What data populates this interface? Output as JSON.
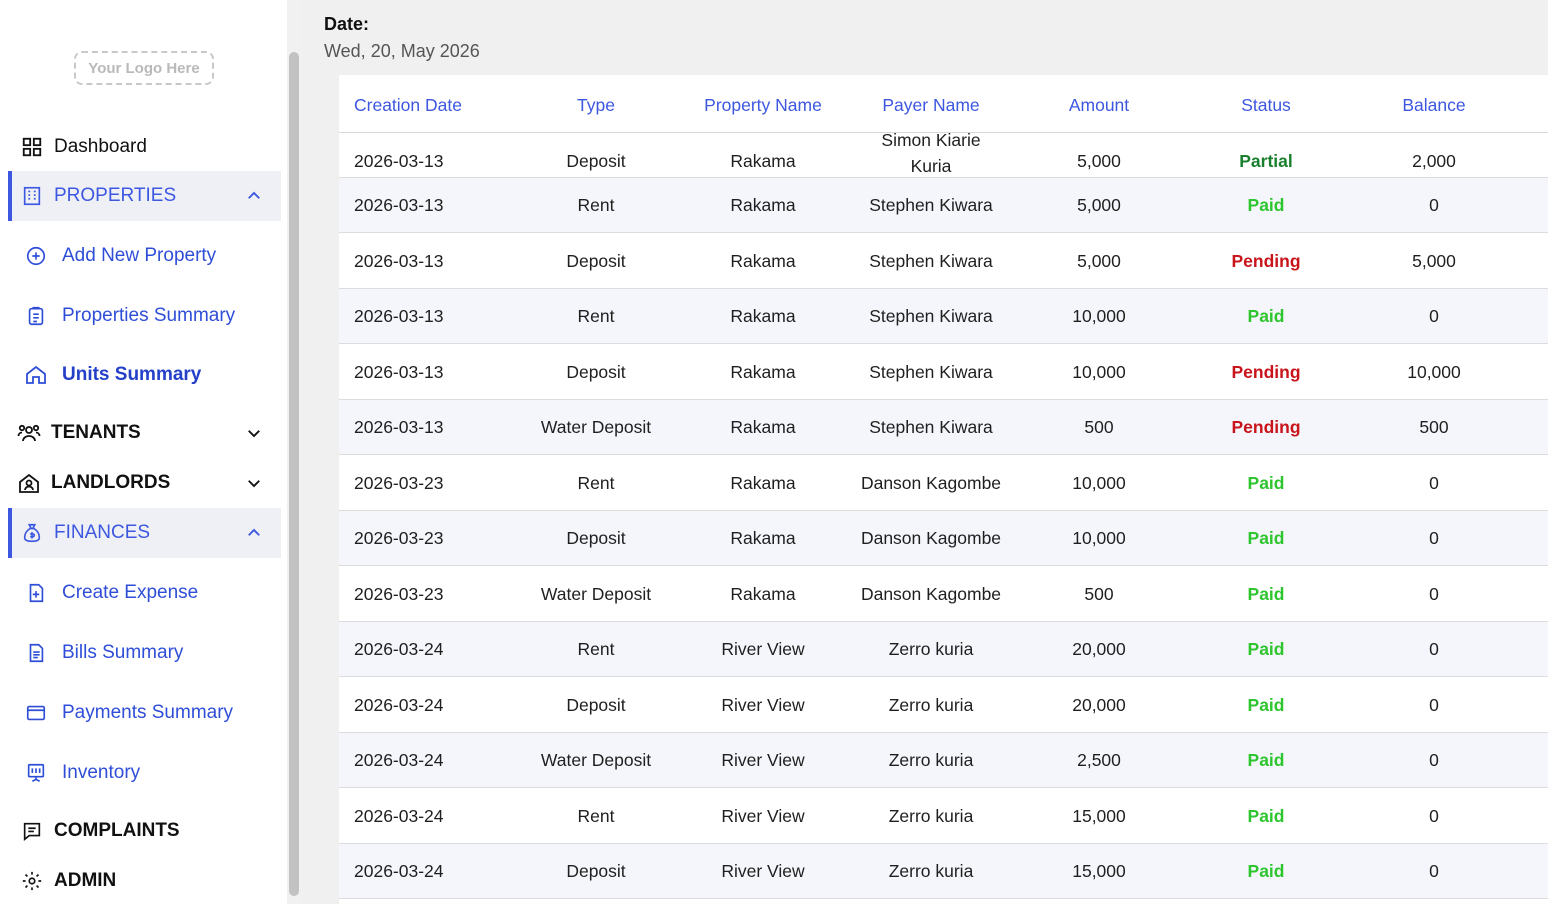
{
  "sidebar": {
    "logo_text": "Your Logo Here",
    "dashboard": "Dashboard",
    "properties": "PROPERTIES",
    "properties_sub": {
      "add_new_property": "Add New Property",
      "properties_summary": "Properties Summary",
      "units_summary": "Units Summary"
    },
    "tenants": "TENANTS",
    "landlords": "LANDLORDS",
    "finances": "FINANCES",
    "finances_sub": {
      "create_expense": "Create Expense",
      "bills_summary": "Bills Summary",
      "payments_summary": "Payments Summary",
      "inventory": "Inventory"
    },
    "complaints": "COMPLAINTS",
    "admin": "ADMIN"
  },
  "header": {
    "date_label": "Date:",
    "date_value": "Wed, 20, May 2026"
  },
  "table": {
    "columns": [
      "Creation Date",
      "Type",
      "Property Name",
      "Payer Name",
      "Amount",
      "Status",
      "Balance"
    ],
    "rows": [
      {
        "date": "2026-03-13",
        "type": "Deposit",
        "property": "Rakama",
        "payer": "Simon Kiarie Kuria",
        "amount": "5,000",
        "status": "Partial",
        "balance": "2,000"
      },
      {
        "date": "2026-03-13",
        "type": "Rent",
        "property": "Rakama",
        "payer": "Stephen Kiwara",
        "amount": "5,000",
        "status": "Paid",
        "balance": "0"
      },
      {
        "date": "2026-03-13",
        "type": "Deposit",
        "property": "Rakama",
        "payer": "Stephen Kiwara",
        "amount": "5,000",
        "status": "Pending",
        "balance": "5,000"
      },
      {
        "date": "2026-03-13",
        "type": "Rent",
        "property": "Rakama",
        "payer": "Stephen Kiwara",
        "amount": "10,000",
        "status": "Paid",
        "balance": "0"
      },
      {
        "date": "2026-03-13",
        "type": "Deposit",
        "property": "Rakama",
        "payer": "Stephen Kiwara",
        "amount": "10,000",
        "status": "Pending",
        "balance": "10,000"
      },
      {
        "date": "2026-03-13",
        "type": "Water Deposit",
        "property": "Rakama",
        "payer": "Stephen Kiwara",
        "amount": "500",
        "status": "Pending",
        "balance": "500"
      },
      {
        "date": "2026-03-23",
        "type": "Rent",
        "property": "Rakama",
        "payer": "Danson Kagombe",
        "amount": "10,000",
        "status": "Paid",
        "balance": "0"
      },
      {
        "date": "2026-03-23",
        "type": "Deposit",
        "property": "Rakama",
        "payer": "Danson Kagombe",
        "amount": "10,000",
        "status": "Paid",
        "balance": "0"
      },
      {
        "date": "2026-03-23",
        "type": "Water Deposit",
        "property": "Rakama",
        "payer": "Danson Kagombe",
        "amount": "500",
        "status": "Paid",
        "balance": "0"
      },
      {
        "date": "2026-03-24",
        "type": "Rent",
        "property": "River View",
        "payer": "Zerro kuria",
        "amount": "20,000",
        "status": "Paid",
        "balance": "0"
      },
      {
        "date": "2026-03-24",
        "type": "Deposit",
        "property": "River View",
        "payer": "Zerro kuria",
        "amount": "20,000",
        "status": "Paid",
        "balance": "0"
      },
      {
        "date": "2026-03-24",
        "type": "Water Deposit",
        "property": "River View",
        "payer": "Zerro kuria",
        "amount": "2,500",
        "status": "Paid",
        "balance": "0"
      },
      {
        "date": "2026-03-24",
        "type": "Rent",
        "property": "River View",
        "payer": "Zerro kuria",
        "amount": "15,000",
        "status": "Paid",
        "balance": "0"
      },
      {
        "date": "2026-03-24",
        "type": "Deposit",
        "property": "River View",
        "payer": "Zerro kuria",
        "amount": "15,000",
        "status": "Paid",
        "balance": "0"
      }
    ]
  },
  "colors": {
    "accent": "#3d57e0",
    "paid": "#2ec52e",
    "pending": "#c8141a",
    "partial": "#19802d"
  }
}
